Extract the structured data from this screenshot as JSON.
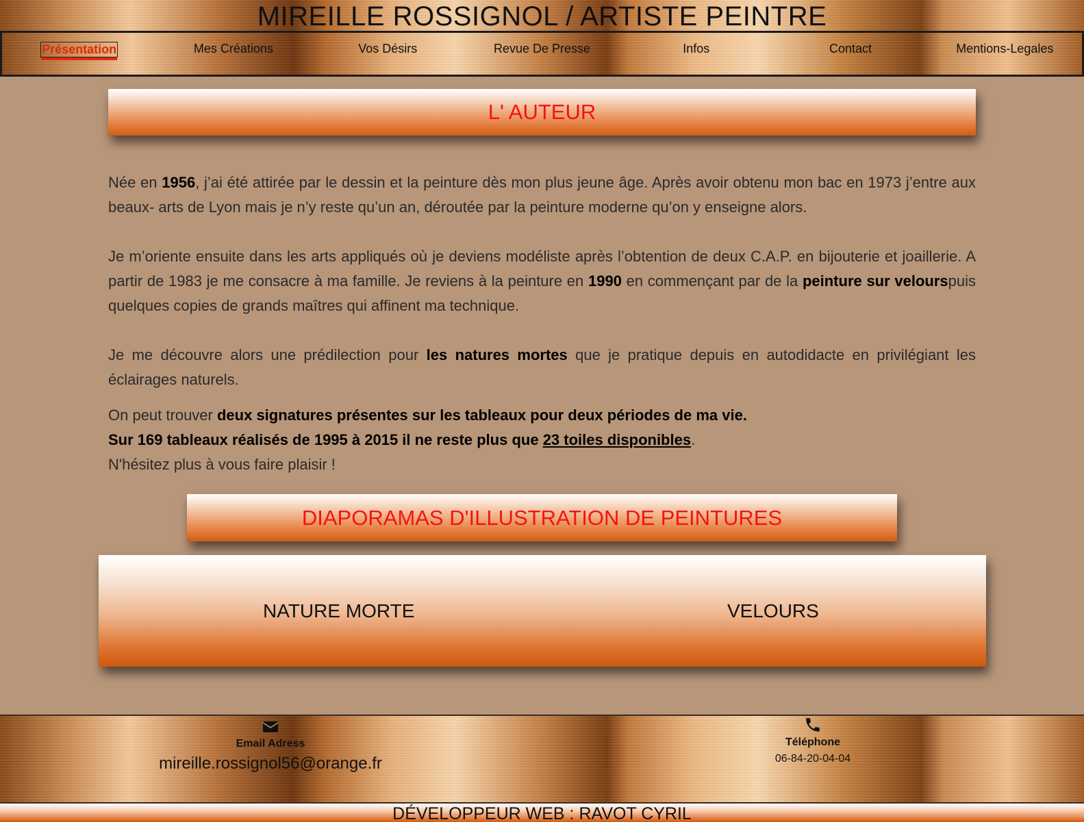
{
  "header": {
    "title": "MIREILLE ROSSIGNOL / ARTISTE PEINTRE"
  },
  "nav": {
    "items": [
      {
        "label": "Présentation",
        "active": true
      },
      {
        "label": "Mes Créations"
      },
      {
        "label": "Vos Désirs"
      },
      {
        "label": "Revue De Presse"
      },
      {
        "label": "Infos"
      },
      {
        "label": "Contact"
      },
      {
        "label": "Mentions-Legales"
      }
    ]
  },
  "auteur": {
    "heading": "L' AUTEUR",
    "p1": {
      "t1": "Née en ",
      "b1": "1956",
      "t2": ", j’ai été attirée par le dessin et la peinture dès mon plus jeune âge. Après avoir obtenu mon bac en 1973 j’entre aux beaux- arts de Lyon mais je n’y reste qu’un an, déroutée par la peinture moderne qu’on y enseigne alors."
    },
    "p2": {
      "t1": "Je m’oriente ensuite dans les arts appliqués où je deviens modéliste après l’obtention de deux C.A.P. en bijouterie et joaillerie. A partir de 1983 je me consacre à ma famille. Je reviens à la peinture en ",
      "b1": "1990",
      "t2": " en commençant par de la ",
      "b2": "peinture sur velours",
      "t3": "puis quelques copies de grands maîtres qui affinent ma technique."
    },
    "p3": {
      "t1": "Je me découvre alors une prédilection pour ",
      "b1": "les natures mortes",
      "t2": " que je pratique depuis en autodidacte en privilégiant les éclairages naturels."
    },
    "p4": {
      "t1": "On peut trouver ",
      "b1": "deux signatures présentes sur les tableaux pour deux périodes de ma vie.",
      "b2": "Sur 169 tableaux réalisés de 1995 à 2015 il ne reste plus que ",
      "link": "23 toiles disponibles",
      "t2": ".",
      "t3": "N'hésitez plus à vous faire plaisir !"
    }
  },
  "diaporamas": {
    "heading": "DIAPORAMAS D'ILLUSTRATION DE PEINTURES",
    "slides": [
      "NATURE MORTE",
      "VELOURS"
    ]
  },
  "footer": {
    "email_icon": "envelope-icon",
    "email_label": "Email Adress",
    "email_value": "mireille.rossignol56@orange.fr",
    "phone_icon": "phone-icon",
    "phone_label": "Téléphone",
    "phone_value": "06-84-20-04-04",
    "developer": "DÉVELOPPEUR WEB : RAVOT CYRIL"
  },
  "colors": {
    "background": "#b8967a",
    "heading_text": "#f5130f",
    "active_nav": "#e22a0a"
  }
}
